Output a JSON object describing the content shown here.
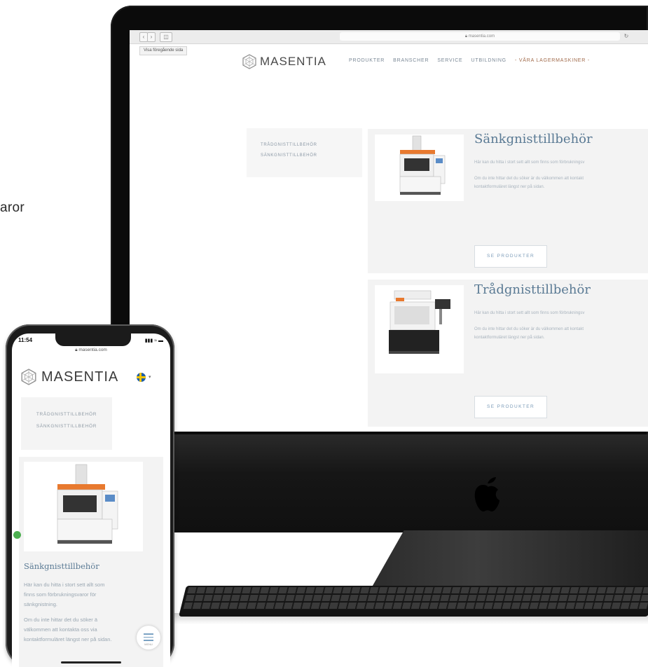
{
  "fragment_text": "aror",
  "browser": {
    "back": "‹",
    "forward": "›",
    "sidebar": "◫",
    "url": "masentia.com",
    "reload": "↻",
    "tooltip": "Visa föregående sida"
  },
  "site": {
    "brand": "MASENTIA",
    "nav": [
      "PRODUKTER",
      "BRANSCHER",
      "SERVICE",
      "UTBILDNING",
      "- VÅRA LAGERMASKINER -"
    ],
    "sidebar": [
      "TRÅDGNISTTILLBEHÖR",
      "SÄNKGNISTTILLBEHÖR"
    ],
    "cards": [
      {
        "title": "Sänkgnisttillbehör",
        "p1": "Här kan du hitta i stort sett allt som finns som förbrukningsv",
        "p2a": "Om du inte hittar det du söker är du välkommen att kontakt",
        "p2b": "kontaktformuläret längst ner på sidan.",
        "button": "SE PRODUKTER"
      },
      {
        "title": "Trådgnisttillbehör",
        "p1": "Här kan du hitta i stort sett allt som finns som förbrukningsv",
        "p2a": "Om du inte hittar det du söker är du välkommen att kontakt",
        "p2b": "kontaktformuläret längst ner på sidan.",
        "button": "SE PRODUKTER"
      }
    ]
  },
  "phone": {
    "time": "11:54",
    "status_icons": "▮▮▮ ≈ ▬",
    "url": "masentia.com",
    "brand": "MASENTIA",
    "lang_caret": "▾",
    "sidebar": [
      "TRÅDGNISTTILLBEHÖR",
      "SÄNKGNISTTILLBEHÖR"
    ],
    "card_title": "Sänkgnisttillbehör",
    "lines": [
      "Här kan du hitta i stort sett allt som",
      "finns som förbrukningsvaror för",
      "sänkgnistning.",
      "Om du inte hittar det du söker ä",
      "välkommen att kontakta oss via",
      "kontaktformuläret längst ner på sidan."
    ],
    "menu_label": "MENU"
  },
  "colors": {
    "title_blue": "#5a7a94",
    "nav_gray": "#7a8896",
    "card_bg": "#f3f3f3"
  }
}
